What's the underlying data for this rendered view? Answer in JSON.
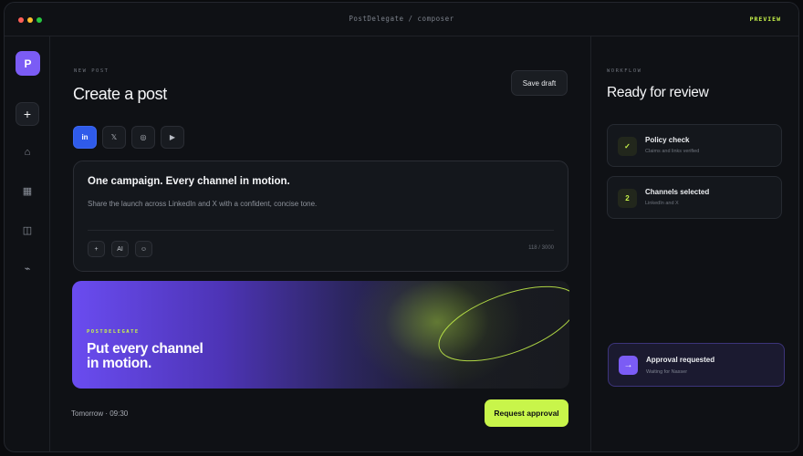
{
  "titlebar": {
    "title": "PostDelegate / composer",
    "badge": "PREVIEW"
  },
  "sidebar": {
    "logo": "P",
    "items": [
      {
        "icon": "plus-icon",
        "glyph": "+"
      },
      {
        "icon": "home-icon",
        "glyph": "⌂"
      },
      {
        "icon": "calendar-icon",
        "glyph": "▦"
      },
      {
        "icon": "library-icon",
        "glyph": "◫"
      },
      {
        "icon": "activity-icon",
        "glyph": "⌁"
      }
    ]
  },
  "main": {
    "eyebrow": "NEW POST",
    "title": "Create a post",
    "save_draft": "Save draft",
    "channels": [
      {
        "name": "linkedin",
        "glyph": "in",
        "selected": true
      },
      {
        "name": "x",
        "glyph": "𝕏",
        "selected": false
      },
      {
        "name": "instagram",
        "glyph": "◎",
        "selected": false
      },
      {
        "name": "youtube",
        "glyph": "▶",
        "selected": false
      }
    ],
    "composer": {
      "headline": "One campaign. Every channel in motion.",
      "body": "Share the launch across LinkedIn and X with a confident, concise tone.",
      "tools": [
        "+",
        "AI",
        "☺"
      ],
      "char_count": "118 / 3000"
    },
    "banner": {
      "eyebrow": "POSTDELEGATE",
      "headline_line1": "Put every channel",
      "headline_line2": "in motion.",
      "accent_color": "#c8f54a"
    },
    "schedule": "Tomorrow · 09:30",
    "request_approval": "Request approval"
  },
  "panel": {
    "eyebrow": "WORKFLOW",
    "title": "Ready for review",
    "steps": [
      {
        "badge": "✓",
        "title": "Policy check",
        "subtitle": "Claims and links verified"
      },
      {
        "badge": "2",
        "title": "Channels selected",
        "subtitle": "LinkedIn and X"
      }
    ],
    "approval": {
      "icon": "→",
      "title": "Approval requested",
      "subtitle": "Waiting for Nasser"
    }
  },
  "colors": {
    "accent": "#c8f54a",
    "brand": "#7b5cf5",
    "linkedin": "#2f5bea"
  }
}
